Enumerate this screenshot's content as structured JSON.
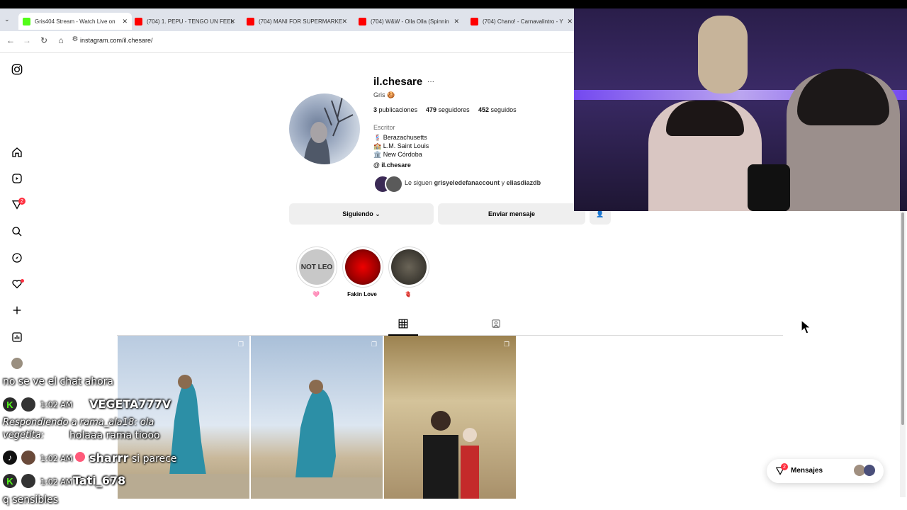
{
  "browser": {
    "tabs": [
      {
        "title": "Gris404 Stream - Watch Live on",
        "favicon": "kick-icon",
        "color": "#53fc18"
      },
      {
        "title": "(704) 1. PEPU - TENGO UN FEEL",
        "favicon": "youtube-icon",
        "color": "#ff0000"
      },
      {
        "title": "(704) MANI FOR SUPERMARKE",
        "favicon": "youtube-icon",
        "color": "#ff0000"
      },
      {
        "title": "(704) W&W - Olla Olla (Spinnin",
        "favicon": "youtube-icon",
        "color": "#ff0000"
      },
      {
        "title": "(704) Chano! - Carnavalintro - Y",
        "favicon": "youtube-icon",
        "color": "#ff0000"
      }
    ],
    "url": "instagram.com/il.chesare/"
  },
  "sidebar": {
    "notifications_badge": "2"
  },
  "profile": {
    "username": "il.chesare",
    "more": "···",
    "name": "Gris 🍪",
    "stats": {
      "posts_count": "3",
      "posts_label": "publicaciones",
      "followers_count": "479",
      "followers_label": "seguidores",
      "following_count": "452",
      "following_label": "seguidos"
    },
    "category": "Escritor",
    "bio_lines": [
      "💈 Berazachusetts",
      "🏫 L.M. Saint Louis",
      "🏛️ New Córdoba"
    ],
    "threads_handle": "il.chesare",
    "followed_by_prefix": "Le siguen",
    "followed_by_1": "grisyeledefanaccount",
    "followed_by_join": "y",
    "followed_by_2": "eliasdiazdb",
    "following_button": "Siguiendo",
    "message_button": "Enviar mensaje"
  },
  "highlights": [
    {
      "label": "🩷",
      "cover_text": "NOT LEO"
    },
    {
      "label": "Fakin Love",
      "cover_text": ""
    },
    {
      "label": "🫀",
      "cover_text": ""
    }
  ],
  "chat": {
    "line1": "no se ve el chat ahora",
    "msg1": {
      "time": "1:02 AM",
      "user": "VEGETA777V"
    },
    "reply_label": "Respondiendo a rama_ala18: ola",
    "reply_user": "vegetita:",
    "reply_text": "holaaa rama tiooo",
    "msg2": {
      "time": "1:02 AM",
      "user": "sharrr",
      "text": "si parece"
    },
    "msg3": {
      "time": "1:02 AM",
      "user": "Tati_678"
    },
    "line_last": "q sensibles"
  },
  "messages_widget": {
    "label": "Mensajes",
    "badge": "2"
  }
}
